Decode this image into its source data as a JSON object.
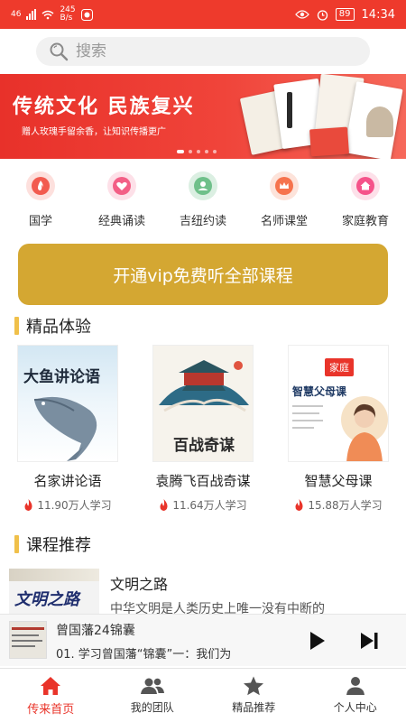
{
  "status_bar": {
    "network": "46",
    "speed": "245",
    "speed_unit": "B/s",
    "battery": "89",
    "time": "14:34"
  },
  "search": {
    "placeholder": "搜索"
  },
  "banner": {
    "title": "传统文化 民族复兴",
    "subtitle": "赠人玫瑰手留余香，让知识传播更广"
  },
  "categories": [
    {
      "label": "国学",
      "icon": "flame-icon",
      "color": "#f25b4f"
    },
    {
      "label": "经典诵读",
      "icon": "heart-icon",
      "color": "#f35f86"
    },
    {
      "label": "吉纽约读",
      "icon": "person-icon",
      "color": "#6fc08a"
    },
    {
      "label": "名师课堂",
      "icon": "crown-icon",
      "color": "#f6734d"
    },
    {
      "label": "家庭教育",
      "icon": "home-icon",
      "color": "#f5538a"
    }
  ],
  "vip": {
    "label": "开通vip免费听全部课程"
  },
  "featured": {
    "title": "精品体验",
    "items": [
      {
        "name": "名家讲论语",
        "stat": "11.90万人学习",
        "cover_text": "大鱼讲论语"
      },
      {
        "name": "袁腾飞百战奇谋",
        "stat": "11.64万人学习",
        "cover_text": "百战奇谋"
      },
      {
        "name": "智慧父母课",
        "stat": "15.88万人学习",
        "cover_text": "智慧父母课",
        "cover_badge": "家庭"
      }
    ]
  },
  "recommend": {
    "title": "课程推荐",
    "items": [
      {
        "title": "文明之路",
        "desc": "中华文明是人类历史上唯一没有中断的",
        "thumb_text": "文明之路"
      }
    ]
  },
  "player": {
    "title": "曾国藩24锦囊",
    "subtitle": "01. 学习曾国藩“锦囊”一：我们为"
  },
  "tabs": [
    {
      "label": "传来首页",
      "icon": "home-icon",
      "active": true
    },
    {
      "label": "我的团队",
      "icon": "team-icon",
      "active": false
    },
    {
      "label": "精品推荐",
      "icon": "star-icon",
      "active": false
    },
    {
      "label": "个人中心",
      "icon": "user-icon",
      "active": false
    }
  ],
  "colors": {
    "accent": "#ee3a2c",
    "vip": "#d4a732",
    "section_bar": "#f0c04a",
    "tab_active": "#e9342a"
  }
}
